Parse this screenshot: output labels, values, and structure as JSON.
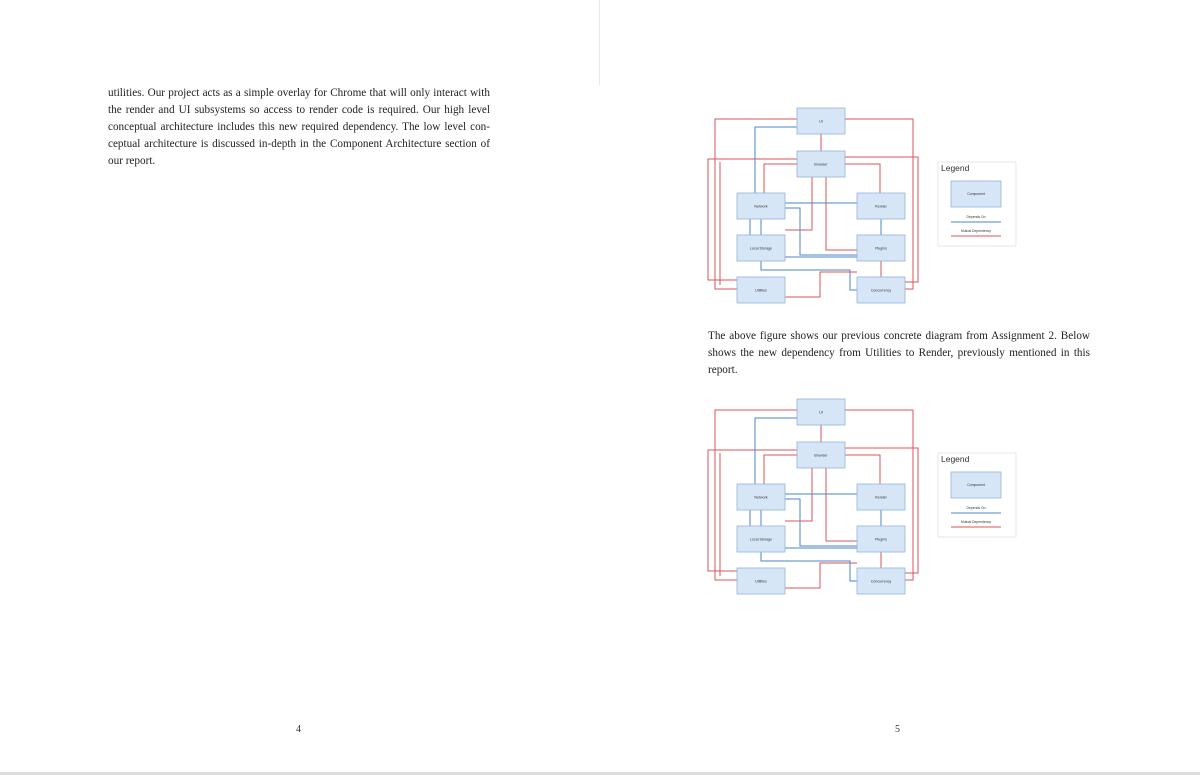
{
  "left_page": {
    "lines": [
      "utilities. Our project acts as a simple overlay for Chrome that will only interact with",
      "the render and UI subsystems so access to render code is required. Our high level",
      "conceptual architecture includes this new required dependency. The low level con-",
      "ceptual architecture is discussed in-depth in the Component Architecture section of",
      "our report."
    ],
    "page_number": "4"
  },
  "right_page": {
    "caption_lines": [
      "The above figure shows our previous concrete diagram from Assignment 2. Below",
      "shows the new dependency from Utilities to Render, previously mentioned in this",
      "report."
    ],
    "page_number": "5"
  },
  "diagram": {
    "components": {
      "ui": "UI",
      "browser": "Browser",
      "network": "Network",
      "render": "Render",
      "local_storage": "Local Storage",
      "plugins": "Plugins",
      "utilities": "Utilities",
      "concurrency": "Concurrency"
    },
    "legend": {
      "title": "Legend",
      "component": "Component",
      "depends_on": "Depends On",
      "mutual": "Mutual Dependency"
    },
    "colors": {
      "box_fill": "#d6e6f7",
      "box_stroke": "#8fb3da",
      "depends": "#4a86c8",
      "mutual": "#d9555a"
    }
  }
}
